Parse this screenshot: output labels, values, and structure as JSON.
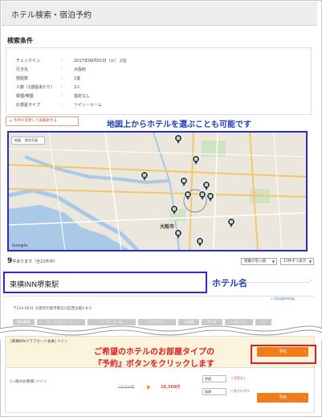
{
  "title_bar": {
    "title": "ホテル検索・宿泊予約"
  },
  "conditions": {
    "heading": "検索条件",
    "rows": [
      {
        "label": "チェックイン",
        "colon": ":",
        "value": "2017年08月01日（火） 2泊"
      },
      {
        "label": "行き先",
        "colon": ":",
        "value": "大阪府"
      },
      {
        "label": "部屋数",
        "colon": ":",
        "value": "1室"
      },
      {
        "label": "人数（1部屋あたり）",
        "colon": ":",
        "value": "2人"
      },
      {
        "label": "禁煙/喫煙",
        "colon": ":",
        "value": "指定なし"
      },
      {
        "label": "お部屋タイプ",
        "colon": ":",
        "value": "ツイン・ルーム"
      }
    ],
    "change_button": "条件を変更して再検索する",
    "change_button_icon": "<"
  },
  "annotations": {
    "map_note": "地図上からホテルを選ぶことも可能です",
    "hotel_name_note": "ホテル名",
    "reserve_note_line1": "ご希望のホテルのお部屋タイプの",
    "reserve_note_line2": "『予約』ボタンをクリックします"
  },
  "map": {
    "tabs": [
      "地図",
      "航空写真"
    ],
    "city_label": "大阪市",
    "google_logo": "Google"
  },
  "results": {
    "count": "9",
    "count_suffix": "件あります（全22件中）",
    "sort_select": "距離が近い順",
    "per_page_select": "10件ずつ表示"
  },
  "hotel": {
    "name": "東横INN堺東駅",
    "address": "〒533-0031 大阪府大阪市東淀川区西淡路2-8-5",
    "google_map_link": "» Googlemap",
    "amenities": [
      "無料朝食",
      "モーニングコーヒー",
      "ハーフ・ルーム",
      "バリアフリー",
      "大浴場",
      "サウナ",
      "レストラン",
      "バー"
    ]
  },
  "plans": [
    {
      "name": "[東横INNクラブカード会員] ツイン",
      "reserve": "予約"
    },
    {
      "name": "[一般のお客様] ツイン",
      "price_old": "19,000円",
      "price_new": "18,360円",
      "smoking_button": "禁煙",
      "smoking_note": "＜空室なし",
      "nonsmoking_button": "喫煙",
      "nonsmoking_note": "＜残りわずか",
      "reserve": "予約"
    }
  ],
  "colors": {
    "accent_orange": "#f07d1a",
    "annotation_blue": "#1f3fb8",
    "annotation_red": "#e02020",
    "pin_navy": "#1d3f73"
  }
}
